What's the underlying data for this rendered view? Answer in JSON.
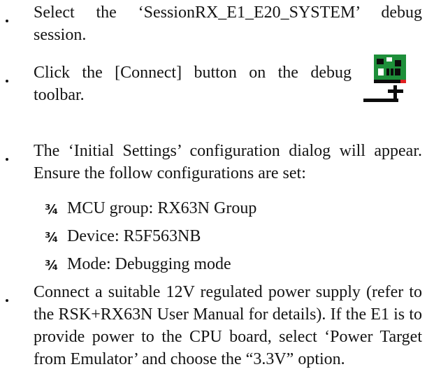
{
  "items": [
    {
      "text": "Select the ‘SessionRX_E1_E20_SYSTEM’ debug session."
    },
    {
      "text": "Click the [Connect] button on the debug toolbar."
    },
    {
      "text": "The ‘Initial Settings’ configuration dialog will appear. Ensure the follow configurations are set:"
    },
    {
      "text": "Connect a suitable 12V regulated power supply (refer to the RSK+RX63N User Manual for details). If the E1 is to provide power to the CPU board, select ‘Power Target from Emulator’ and choose the “3.3V” option."
    }
  ],
  "subitems": [
    {
      "marker": "¾",
      "text": "MCU group: RX63N Group"
    },
    {
      "marker": "¾",
      "text": "Device: R5F563NB"
    },
    {
      "marker": "¾",
      "text": "Mode: Debugging mode"
    }
  ],
  "icons": {
    "connect": "connect-icon"
  }
}
